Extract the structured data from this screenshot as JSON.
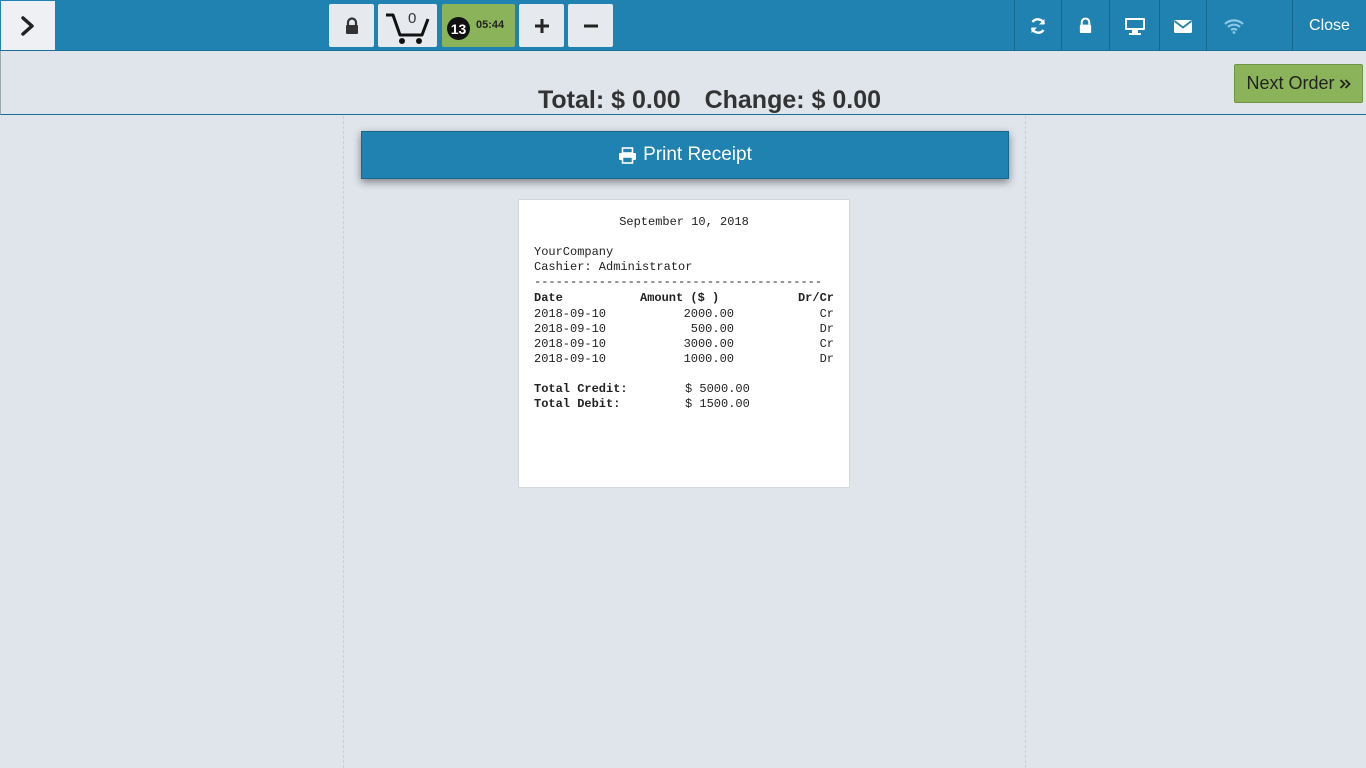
{
  "topbar": {
    "cart_count": "0",
    "order_number": "13",
    "order_time": "05:44",
    "close_label": "Close"
  },
  "totals": {
    "total_label": "Total:",
    "total_value": "$ 0.00",
    "change_label": "Change:",
    "change_value": "$ 0.00",
    "next_order_label": "Next Order"
  },
  "print_button_label": "Print Receipt",
  "receipt": {
    "date": "September 10, 2018",
    "company": "YourCompany",
    "cashier": "Cashier: Administrator",
    "separator": "----------------------------------------",
    "headers": {
      "date": "Date",
      "amount": "Amount ($ )",
      "drcr": "Dr/Cr"
    },
    "rows": [
      {
        "date": "2018-09-10",
        "amount": "2000.00",
        "drcr": "Cr"
      },
      {
        "date": "2018-09-10",
        "amount": "500.00",
        "drcr": "Dr"
      },
      {
        "date": "2018-09-10",
        "amount": "3000.00",
        "drcr": "Cr"
      },
      {
        "date": "2018-09-10",
        "amount": "1000.00",
        "drcr": "Dr"
      }
    ],
    "total_credit_label": "Total Credit:",
    "total_credit_value": "$ 5000.00",
    "total_debit_label": "Total Debit:",
    "total_debit_value": "$ 1500.00"
  },
  "colors": {
    "topbar": "#1f82b1",
    "accent_green": "#8ab35a",
    "background": "#e0e5ec"
  },
  "icons": [
    "chevron-right-icon",
    "lock-icon",
    "cart-icon",
    "plus-icon",
    "minus-icon",
    "sync-icon",
    "desktop-icon",
    "envelope-icon",
    "wifi-icon",
    "printer-icon",
    "double-chevron-right-icon"
  ]
}
